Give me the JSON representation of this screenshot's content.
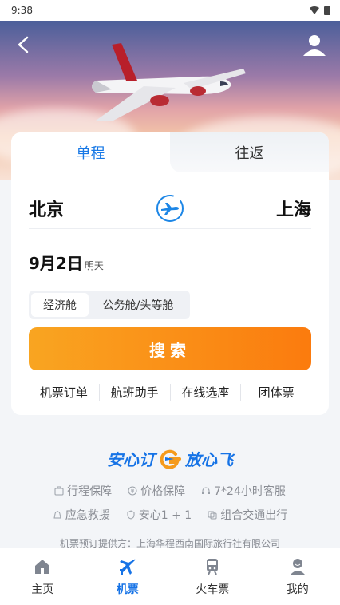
{
  "status_bar": {
    "time": "9:38"
  },
  "tabs": {
    "one_way": "单程",
    "round_trip": "往返"
  },
  "route": {
    "from": "北京",
    "to": "上海"
  },
  "date": {
    "main": "9月2日",
    "sub": "明天"
  },
  "cabin": {
    "economy": "经济舱",
    "business_first": "公务舱/头等舱"
  },
  "search": {
    "label": "搜索"
  },
  "quick_links": [
    "机票订单",
    "航班助手",
    "在线选座",
    "团体票"
  ],
  "slogan": {
    "left": "安心订",
    "right": "放心飞"
  },
  "features": {
    "row1": [
      "行程保障",
      "价格保障",
      "7*24小时客服"
    ],
    "row2": [
      "应急救援",
      "安心1 + 1",
      "组合交通出行"
    ]
  },
  "provider": "机票预订提供方：上海华程西南国际旅行社有限公司",
  "bottom_nav": [
    "主页",
    "机票",
    "火车票",
    "我的"
  ],
  "colors": {
    "accent": "#1673e6",
    "search_start": "#f9a521",
    "search_end": "#fb7b0e"
  }
}
